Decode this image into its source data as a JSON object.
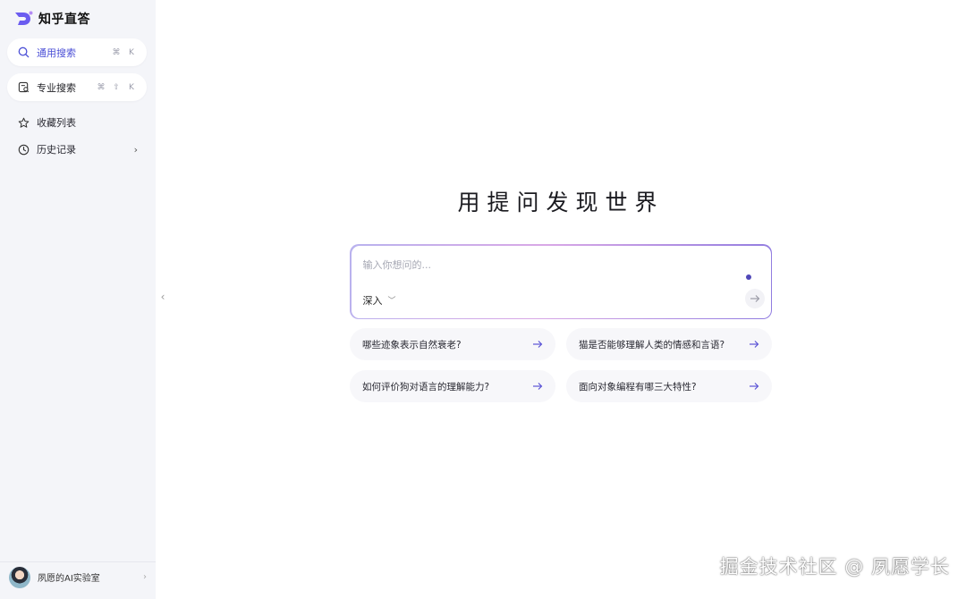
{
  "brand": {
    "name": "知乎直答",
    "logo_icon": "zhida-logo-icon",
    "accent": "#6b5cf0"
  },
  "sidebar": {
    "general_search": {
      "label": "通用搜索",
      "icon": "search-icon",
      "shortcut": [
        "⌘",
        "K"
      ]
    },
    "pro_search": {
      "label": "专业搜索",
      "icon": "document-search-icon",
      "shortcut": [
        "⌘",
        "⇧",
        "K"
      ]
    },
    "favorites": {
      "label": "收藏列表",
      "icon": "star-icon"
    },
    "history": {
      "label": "历史记录",
      "icon": "clock-icon",
      "chevron": "›"
    },
    "collapse_glyph": "‹",
    "user": {
      "name": "夙愿的AI实验室",
      "chevron": "›"
    }
  },
  "main": {
    "headline": "用提问发现世界",
    "ask": {
      "placeholder": "输入你想问的...",
      "mode": "深入",
      "mode_chevron": "﹀"
    },
    "suggestions": [
      {
        "text": "哪些迹象表示自然衰老?"
      },
      {
        "text": "猫是否能够理解人类的情感和言语?"
      },
      {
        "text": "如何评价狗对语言的理解能力?"
      },
      {
        "text": "面向对象编程有哪三大特性?"
      }
    ]
  },
  "watermark": "掘金技术社区 @ 夙愿学长",
  "colors": {
    "accent": "#4b4fd6",
    "sidebar_bg": "#f4f5f9",
    "arrow": "#5b54d6"
  }
}
